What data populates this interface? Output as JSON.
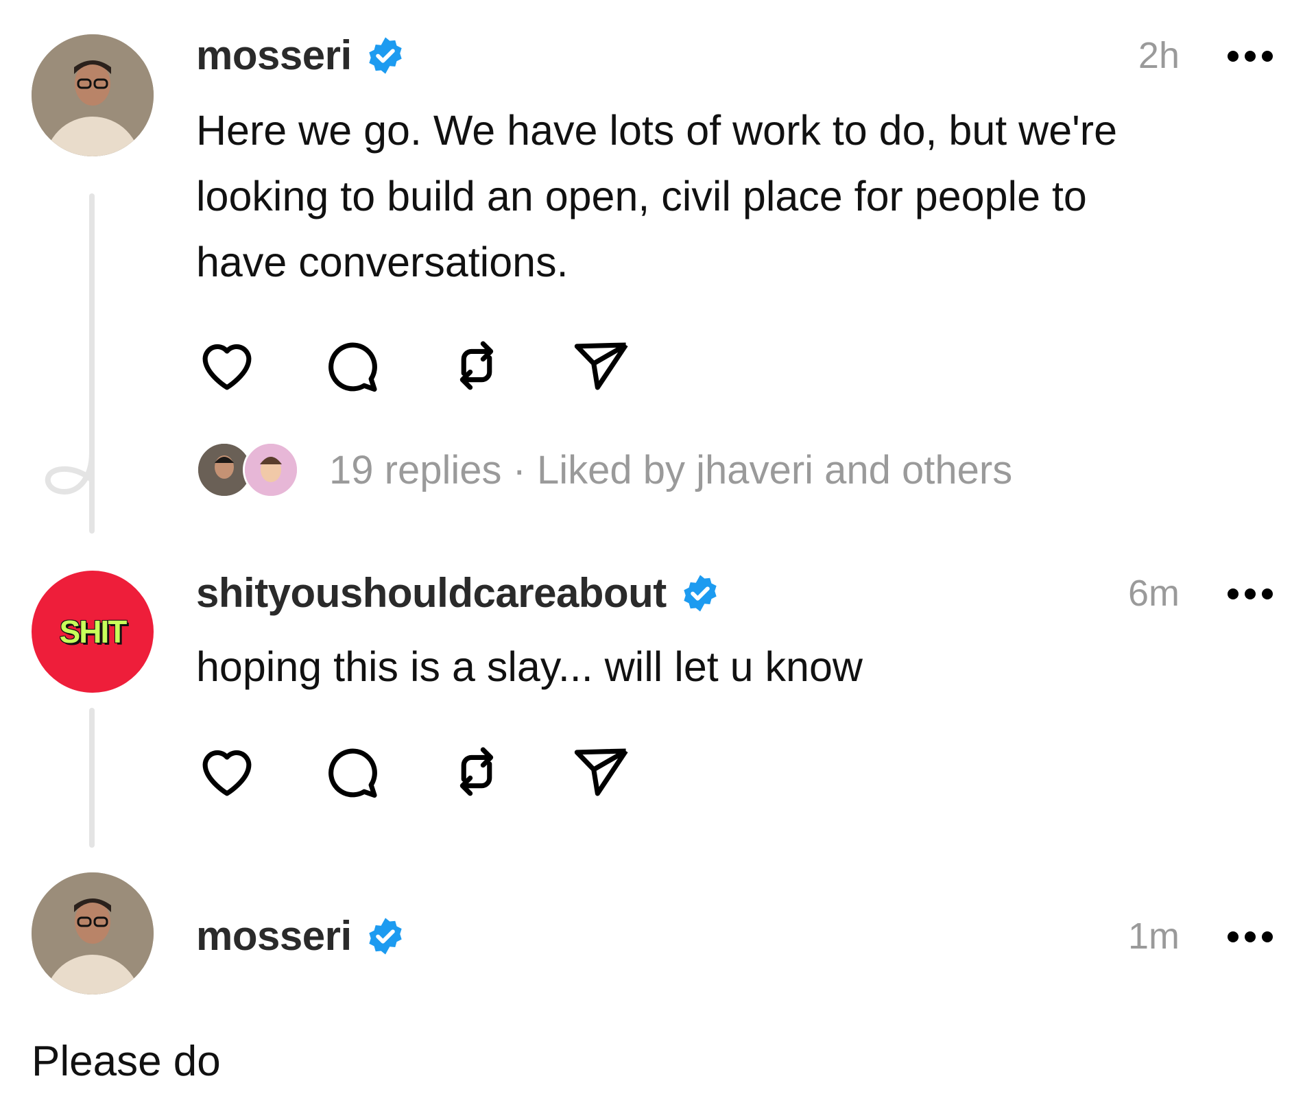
{
  "posts": [
    {
      "username": "mosseri",
      "verified": true,
      "time": "2h",
      "text_lines": [
        "Here we go. We have lots of work to do, but we're",
        "looking to build an open, civil place for people to",
        "have conversations."
      ],
      "replies_summary": "19 replies · Liked by jhaveri and others"
    },
    {
      "username": "shityoushouldcareabout",
      "avatar_text": "SHIT",
      "verified": true,
      "time": "6m",
      "text_lines": [
        "hoping this is a slay... will let u know"
      ]
    },
    {
      "username": "mosseri",
      "verified": true,
      "time": "1m",
      "text_lines": [
        "Please do"
      ]
    }
  ],
  "icons": [
    "heart-icon",
    "comment-icon",
    "repost-icon",
    "share-icon",
    "more-icon",
    "verified-badge-icon"
  ],
  "colors": {
    "verified_blue": "#1d9bf0",
    "shit_avatar_bg": "#ee1e3a",
    "muted_text": "#9a9a9a",
    "thread_line": "#e4e4e4"
  }
}
